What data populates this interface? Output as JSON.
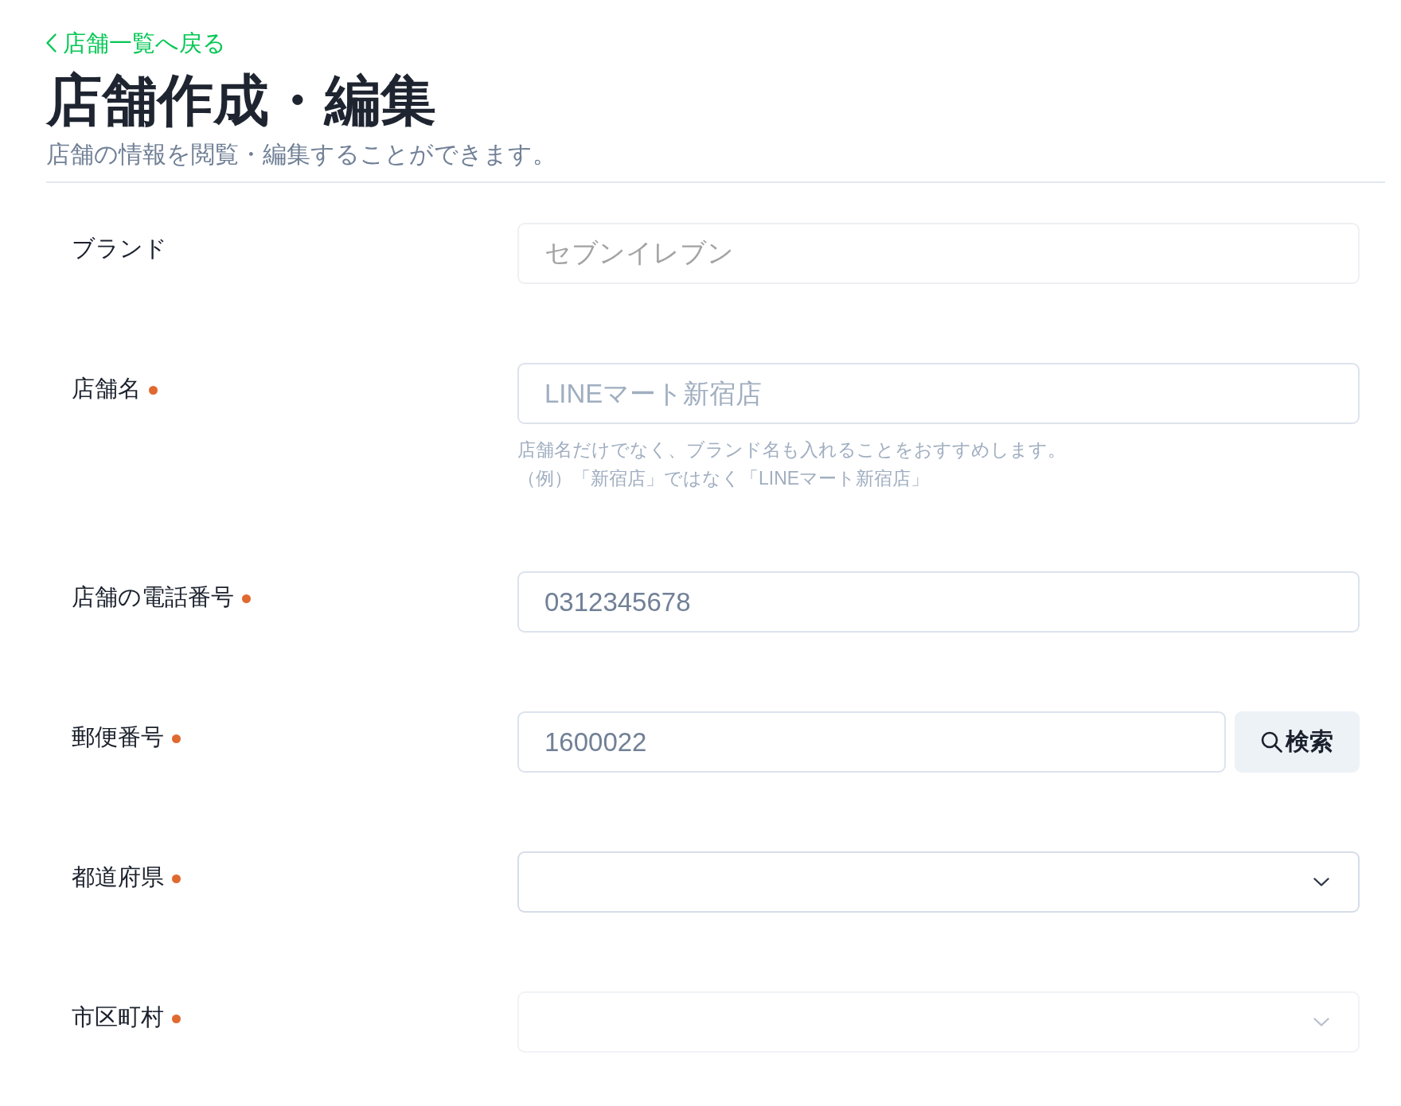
{
  "back_link": {
    "label": "店舗一覧へ戻る"
  },
  "header": {
    "title": "店舗作成・編集",
    "subtitle": "店舗の情報を閲覧・編集することができます。"
  },
  "fields": [
    {
      "kind": "text",
      "label": "ブランド",
      "required": false,
      "disabled": true,
      "value": "セブンイレブン"
    },
    {
      "kind": "text",
      "label": "店舗名",
      "required": true,
      "disabled": false,
      "placeholder": "LINEマート新宿店",
      "help": [
        "店舗名だけでなく、ブランド名も入れることをおすすめします。",
        "（例）「新宿店」ではなく「LINEマート新宿店」"
      ]
    },
    {
      "kind": "text",
      "label": "店舗の電話番号",
      "required": true,
      "disabled": false,
      "value": "0312345678"
    },
    {
      "kind": "search",
      "label": "郵便番号",
      "required": true,
      "disabled": false,
      "value": "1600022",
      "button": "検索"
    },
    {
      "kind": "select",
      "label": "都道府県",
      "required": true,
      "disabled": false
    },
    {
      "kind": "select",
      "label": "市区町村",
      "required": true,
      "disabled": true
    }
  ]
}
